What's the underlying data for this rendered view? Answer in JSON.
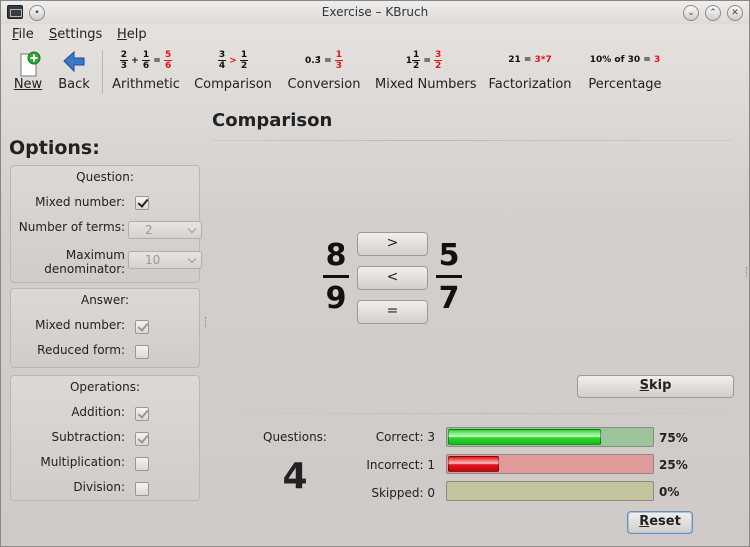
{
  "window": {
    "title": "Exercise – KBruch"
  },
  "menu": [
    {
      "label": "File",
      "mnemonic": "F",
      "rest": "ile"
    },
    {
      "label": "Settings",
      "mnemonic": "S",
      "rest": "ettings"
    },
    {
      "label": "Help",
      "mnemonic": "H",
      "rest": "elp"
    }
  ],
  "toolbar": {
    "new_label": "New",
    "back_label": "Back",
    "tabs": [
      {
        "label": "Arithmetic"
      },
      {
        "label": "Comparison"
      },
      {
        "label": "Conversion"
      },
      {
        "label": "Mixed Numbers"
      },
      {
        "label": "Factorization"
      },
      {
        "label": "Percentage"
      }
    ],
    "icons": {
      "arithmetic": {
        "a_num": "2",
        "a_den": "3",
        "op": "+",
        "b_num": "1",
        "b_den": "6",
        "eq": "=",
        "r_num": "5",
        "r_den": "6"
      },
      "comparison": {
        "a_num": "3",
        "a_den": "4",
        "op": ">",
        "b_num": "1",
        "b_den": "2"
      },
      "conversion": {
        "value": "0.3̄",
        "eq": "=",
        "r_num": "1",
        "r_den": "3"
      },
      "mixed": {
        "whole": "1",
        "a_num": "1",
        "a_den": "2",
        "eq": "=",
        "r_num": "3",
        "r_den": "2"
      },
      "factorization": {
        "left": "21 =",
        "right": "3*7"
      },
      "percentage": {
        "left": "10% of 30 =",
        "right": "3"
      }
    }
  },
  "page_title": "Comparison",
  "options": {
    "title": "Options:",
    "question": {
      "title": "Question:",
      "mixed_label": "Mixed number:",
      "mixed_checked": true,
      "terms_label": "Number of terms:",
      "terms_value": "2",
      "maxden_label_1": "Maximum",
      "maxden_label_2": "denominator:",
      "maxden_value": "10"
    },
    "answer": {
      "title": "Answer:",
      "mixed_label": "Mixed number:",
      "mixed_checked": true,
      "reduced_label": "Reduced form:",
      "reduced_checked": false
    },
    "operations": {
      "title": "Operations:",
      "addition_label": "Addition:",
      "addition_checked": true,
      "subtraction_label": "Subtraction:",
      "subtraction_checked": true,
      "multiplication_label": "Multiplication:",
      "multiplication_checked": false,
      "division_label": "Division:",
      "division_checked": false
    }
  },
  "exercise": {
    "left": {
      "num": "8",
      "den": "9"
    },
    "right": {
      "num": "5",
      "den": "7"
    },
    "buttons": {
      "gt": ">",
      "lt": "<",
      "eq": "="
    },
    "skip_label": "Skip",
    "skip_mnemonic": "S",
    "skip_rest": "kip"
  },
  "stats": {
    "questions_label": "Questions:",
    "questions_count": "4",
    "correct_label": "Correct: 3",
    "correct_pct": "75%",
    "correct_fraction": 0.75,
    "incorrect_label": "Incorrect: 1",
    "incorrect_pct": "25%",
    "incorrect_fraction": 0.25,
    "skipped_label": "Skipped: 0",
    "skipped_pct": "0%",
    "skipped_fraction": 0,
    "reset_label": "Reset",
    "reset_mnemonic": "R",
    "reset_rest": "eset"
  },
  "colors": {
    "correct": "#2fd82f",
    "correct_track": "#9cc49c",
    "incorrect": "#e8141c",
    "incorrect_track": "#e09a9a",
    "skipped_track": "#c4c49c",
    "highlight": "#e0141c"
  }
}
